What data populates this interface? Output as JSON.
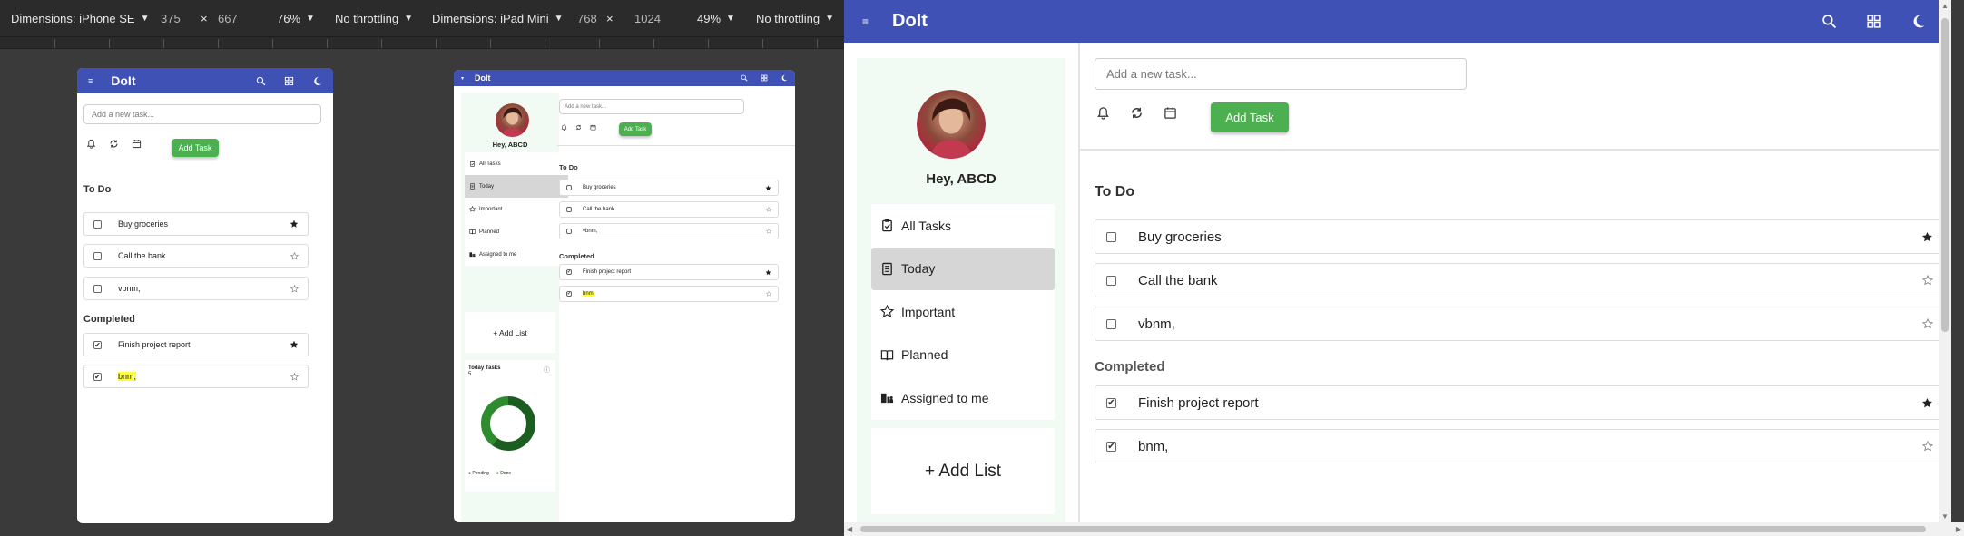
{
  "devtools": {
    "left": {
      "dimensions": "Dimensions: iPhone SE",
      "width": "375",
      "x": "×",
      "height": "667",
      "zoom": "76%",
      "throttle": "No throttling"
    },
    "right": {
      "dimensions": "Dimensions: iPad Mini",
      "width": "768",
      "x": "×",
      "height": "1024",
      "zoom": "49%",
      "throttle": "No throttling"
    }
  },
  "app": {
    "brand": "DoIt",
    "menu_icon": "menu-icon",
    "search_icon": "search-icon",
    "grid_icon": "grid-icon",
    "theme_icon": "moon-icon",
    "input_placeholder": "Add a new task...",
    "add_task_label": "Add Task",
    "todo_title": "To Do",
    "completed_title": "Completed",
    "todo": [
      {
        "text": "Buy groceries",
        "starred": true
      },
      {
        "text": "Call the bank",
        "starred": false
      },
      {
        "text": "vbnm,",
        "starred": false
      }
    ],
    "completed": [
      {
        "text": "Finish project report",
        "starred": true
      },
      {
        "text": "bnm,",
        "starred": false
      }
    ],
    "greeting": "Hey, ABCD",
    "nav": [
      {
        "label": "All Tasks",
        "icon": "clipboard-check-icon"
      },
      {
        "label": "Today",
        "icon": "calendar-page-icon",
        "active": true
      },
      {
        "label": "Important",
        "icon": "star-outline-icon"
      },
      {
        "label": "Planned",
        "icon": "book-icon"
      },
      {
        "label": "Assigned to me",
        "icon": "people-icon"
      }
    ],
    "add_list_label": "+ Add List",
    "today_tasks_title": "Today Tasks",
    "today_tasks_count": "5",
    "legend_pending": "Pending",
    "legend_done": "Done",
    "colors": {
      "appbar": "#3f51b5",
      "add_task": "#4caf50",
      "sidebar": "#f1faf3",
      "donut_pending": "#1b5e20",
      "donut_done": "#2e8b2e",
      "highlight": "#ffff3a"
    }
  },
  "chart_data": {
    "type": "pie",
    "title": "Today Tasks",
    "categories": [
      "Pending",
      "Done"
    ],
    "values": [
      3,
      2
    ]
  }
}
